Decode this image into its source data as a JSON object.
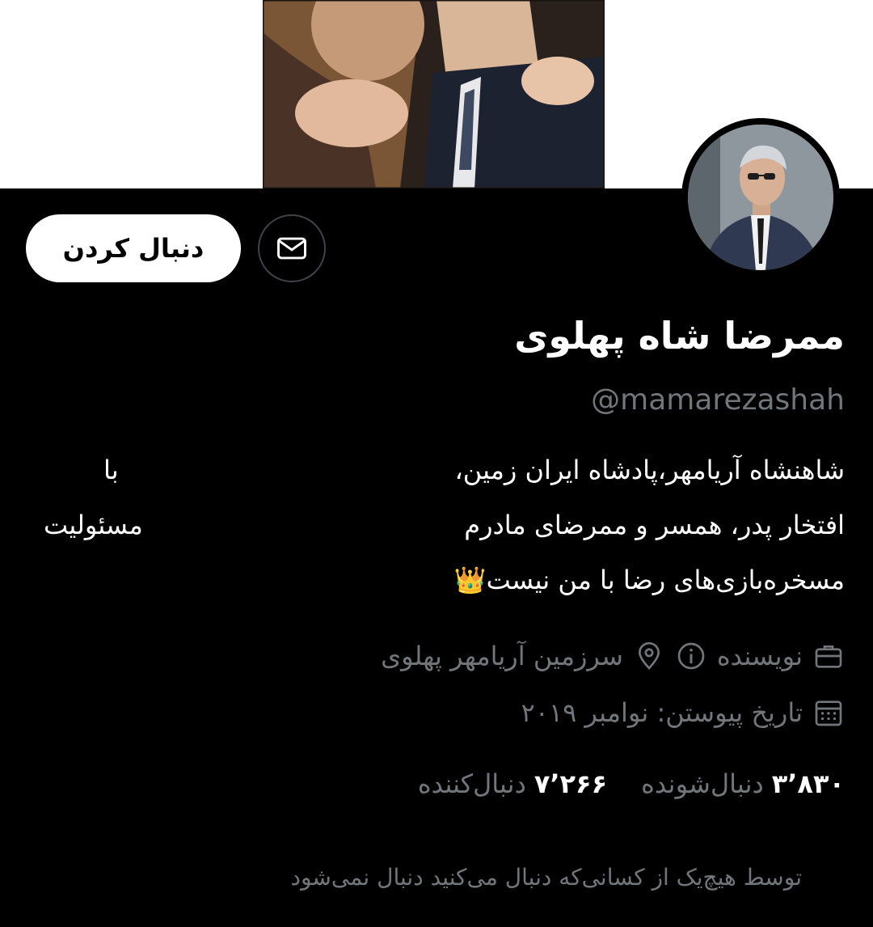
{
  "profile": {
    "display_name": "ممرضا شاه پهلوی",
    "handle": "@mamarezashah",
    "bio_lines": [
      "شاهنشاه آریامهر،پادشاه ایران زمین،",
      "افتخار پدر، همسر و ممرضای مادرم",
      "مسخره‌بازی‌های رضا با من نیست👑"
    ],
    "bio_aside": [
      "با",
      "مسئولیت"
    ],
    "category": "نویسنده",
    "location": "سرزمین آریامهر پهلوی",
    "joined": "تاریخ پیوستن: نوامبر ۲۰۱۹",
    "followers_count": "۷٬۲۶۶",
    "followers_label": "دنبال‌کننده",
    "following_count": "۳٬۸۳۰",
    "following_label": "دنبال‌شونده",
    "not_followed_note": "توسط هیچ‌یک از کسانی‌که دنبال می‌کنید دنبال نمی‌شود"
  },
  "actions": {
    "follow_label": "دنبال کردن",
    "message_icon": "envelope-icon"
  },
  "icons": {
    "category": "briefcase-icon",
    "info": "info-icon",
    "location": "location-pin-icon",
    "joined": "calendar-icon"
  },
  "colors": {
    "background": "#000000",
    "primary_text": "#ffffff",
    "secondary_text": "#71767b",
    "follow_button_bg": "#ffffff",
    "follow_button_text": "#000000",
    "outline": "#3e4349"
  }
}
